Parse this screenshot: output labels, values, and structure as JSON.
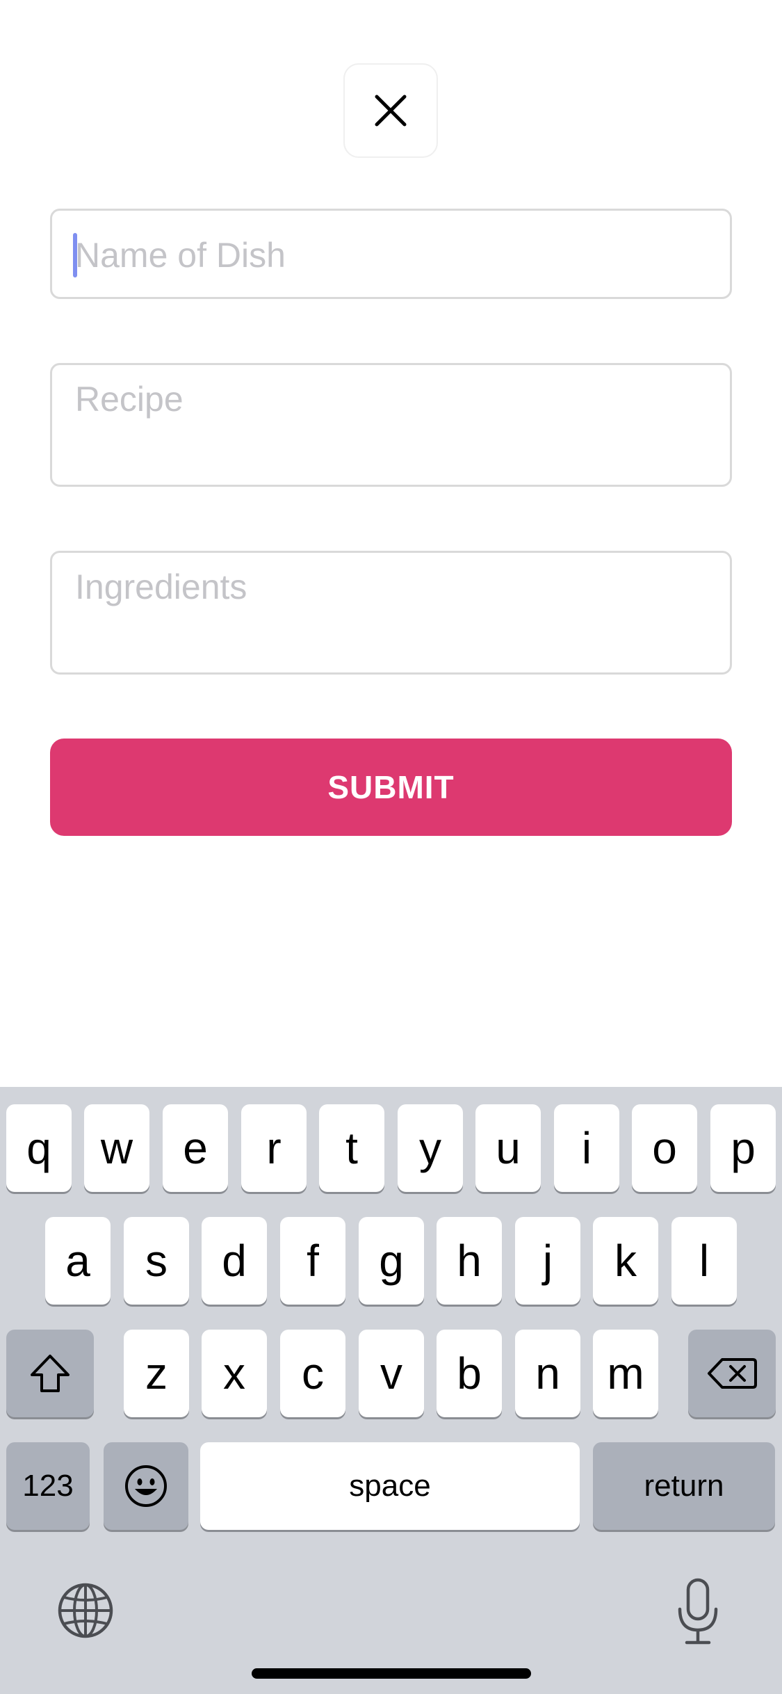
{
  "form": {
    "name_placeholder": "Name of Dish",
    "recipe_placeholder": "Recipe",
    "ingredients_placeholder": "Ingredients",
    "submit_label": "SUBMIT"
  },
  "close_icon": "close-icon",
  "colors": {
    "accent": "#dd3970",
    "placeholder": "#c4c4c8",
    "caret": "#7f8ff0",
    "keyboard_bg": "#d1d4da"
  },
  "keyboard": {
    "row1": [
      "q",
      "w",
      "e",
      "r",
      "t",
      "y",
      "u",
      "i",
      "o",
      "p"
    ],
    "row2": [
      "a",
      "s",
      "d",
      "f",
      "g",
      "h",
      "j",
      "k",
      "l"
    ],
    "row3": [
      "z",
      "x",
      "c",
      "v",
      "b",
      "n",
      "m"
    ],
    "numbers_label": "123",
    "space_label": "space",
    "return_label": "return",
    "icons": {
      "shift": "shift-icon",
      "delete": "delete-icon",
      "emoji": "emoji-icon",
      "globe": "globe-icon",
      "mic": "microphone-icon"
    }
  }
}
